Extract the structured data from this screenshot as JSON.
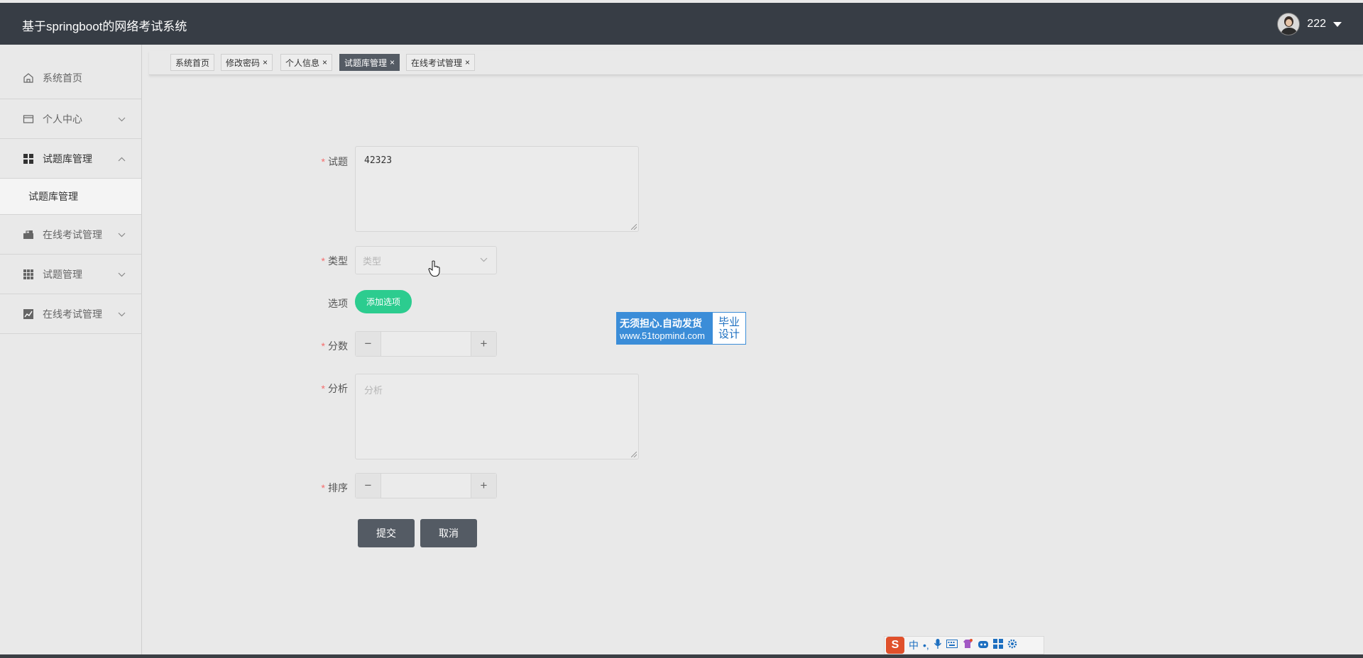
{
  "header": {
    "title": "基于springboot的网络考试系统",
    "user": "222"
  },
  "sidebar": {
    "items": [
      {
        "label": "系统首页",
        "icon": "home-icon"
      },
      {
        "label": "个人中心",
        "icon": "card-icon"
      },
      {
        "label": "试题库管理",
        "icon": "grid-icon"
      },
      {
        "label": "在线考试管理",
        "icon": "briefcase-icon"
      },
      {
        "label": "试题管理",
        "icon": "apps-icon"
      },
      {
        "label": "在线考试管理",
        "icon": "chart-icon"
      }
    ],
    "subitem": "试题库管理"
  },
  "tabs": [
    {
      "label": "系统首页",
      "close": ""
    },
    {
      "label": "修改密码",
      "close": "×"
    },
    {
      "label": "个人信息",
      "close": "×"
    },
    {
      "label": "试题库管理",
      "close": "×"
    },
    {
      "label": "在线考试管理",
      "close": "×"
    }
  ],
  "form": {
    "question_label": "试题",
    "question_value": "42323",
    "type_label": "类型",
    "type_placeholder": "类型",
    "options_label": "选项",
    "add_option": "添加选项",
    "score_label": "分数",
    "analysis_label": "分析",
    "analysis_placeholder": "分析",
    "order_label": "排序",
    "required_mark": "*",
    "submit": "提交",
    "cancel": "取消",
    "minus": "−",
    "plus": "+"
  },
  "watermark": {
    "line1": "无须担心.自动发货",
    "line2": "www.51topmind.com",
    "right1": "毕业",
    "right2": "设计"
  },
  "ime": {
    "logo": "S",
    "mode": "中",
    "punct": "•,"
  },
  "colors": {
    "header_bg": "#373d45",
    "active_tab": "#545b64",
    "add_button": "#2ccc8f",
    "required": "#f56c6c"
  }
}
